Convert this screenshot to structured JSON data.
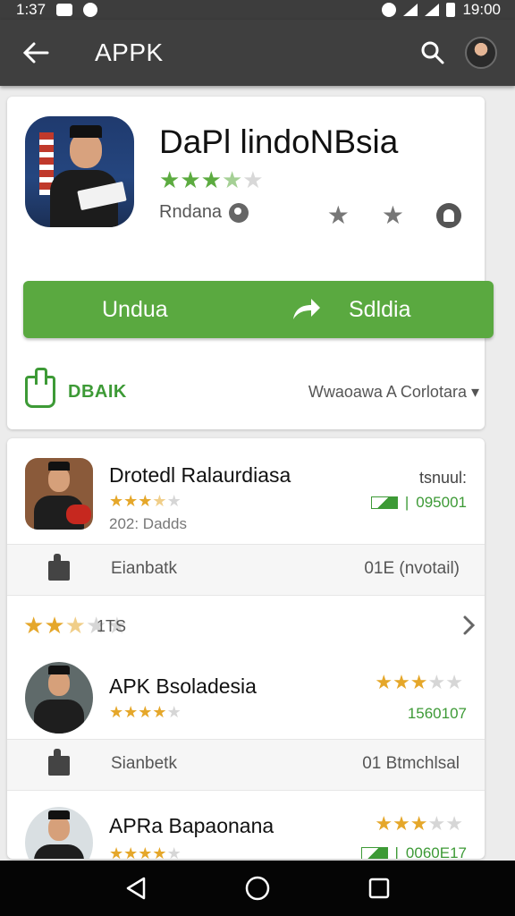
{
  "status_bar": {
    "time": "1:37",
    "right_time": "19:00"
  },
  "app_bar": {
    "title": "APPK"
  },
  "hero": {
    "title": "DaPl lindoNBsia",
    "rating": 3.5,
    "developer": "Rndana"
  },
  "install": {
    "left_label": "Undua",
    "right_label": "Sdldia"
  },
  "hero_footer": {
    "label": "DBAIK",
    "right_text": "Wwaoawa A Corlotara ▾"
  },
  "list": {
    "items": [
      {
        "title": "Drotedl Ralaurdiasa",
        "rating": 3.5,
        "sub": "202: Dadds",
        "right_top": "tsnuul:",
        "right_value": "095001",
        "sub_row_label": "Eianbatk",
        "sub_row_right": "01E (nvotail)"
      },
      {
        "title": "APK Bsoladesia",
        "rating": 4,
        "right_rating": 3,
        "right_value": "1560107",
        "sub_row_label": "Sianbetk",
        "sub_row_right": "01 Btmchlsal"
      },
      {
        "title": "APRa Bapaonana",
        "rating": 4,
        "right_rating": 3,
        "right_value": "0060E17"
      }
    ],
    "rating_row": {
      "rating": 2.5,
      "count": "1TS"
    }
  },
  "icons": {
    "back": "arrow-left-icon",
    "search": "search-icon",
    "share": "share-icon",
    "verified": "verified-icon",
    "like": "thumb-up-icon",
    "chevron": "chevron-right-icon",
    "nav": [
      "back-triangle-icon",
      "home-circle-icon",
      "recents-square-icon"
    ]
  },
  "colors": {
    "accent_green": "#5aa940",
    "star_gold": "#e5a72a",
    "app_bar": "#3f3f3f"
  }
}
